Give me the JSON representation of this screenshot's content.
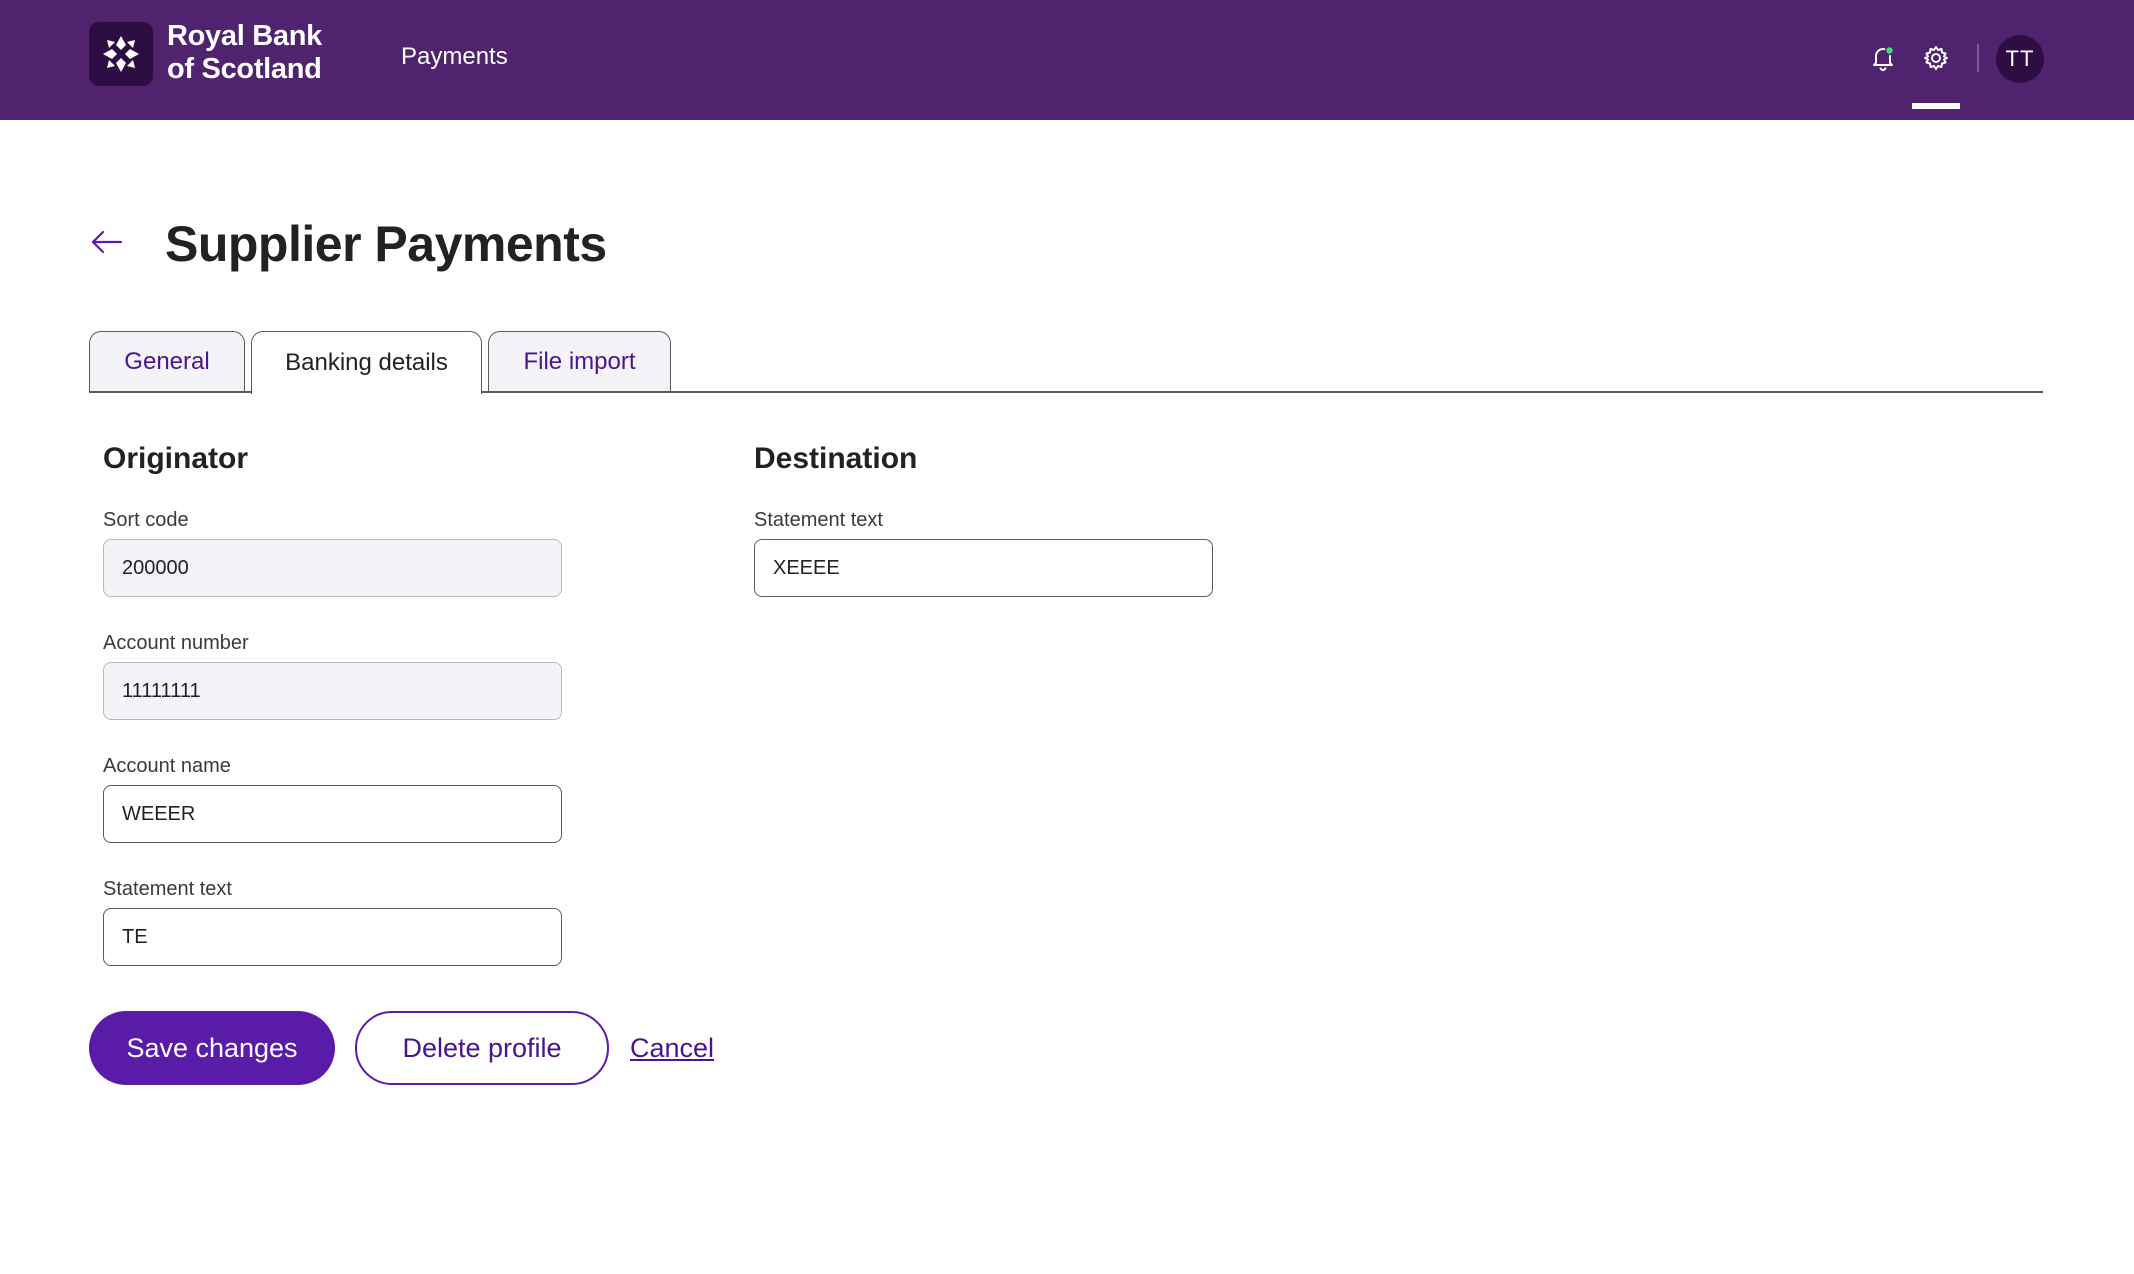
{
  "brand": {
    "line1": "Royal Bank",
    "line2": "of Scotland"
  },
  "header": {
    "nav_payments": "Payments",
    "avatar_initials": "TT",
    "notification_dot_color": "#3ddc84"
  },
  "page": {
    "title": "Supplier Payments"
  },
  "tabs": [
    {
      "label": "General"
    },
    {
      "label": "Banking details",
      "active": true
    },
    {
      "label": "File import"
    }
  ],
  "originator": {
    "title": "Originator",
    "sort_code": {
      "label": "Sort code",
      "value": "200000"
    },
    "account_number": {
      "label": "Account number",
      "value": "11111111"
    },
    "account_name": {
      "label": "Account name",
      "value": "WEEER"
    },
    "statement_text": {
      "label": "Statement text",
      "value": "TE"
    }
  },
  "destination": {
    "title": "Destination",
    "statement_text": {
      "label": "Statement text",
      "value": "XEEEE"
    }
  },
  "actions": {
    "save_label": "Save changes",
    "delete_label": "Delete profile",
    "cancel_label": "Cancel"
  },
  "colors": {
    "header_bg": "#4f236e",
    "primary": "#5a1ba8",
    "link": "#4a148c"
  }
}
